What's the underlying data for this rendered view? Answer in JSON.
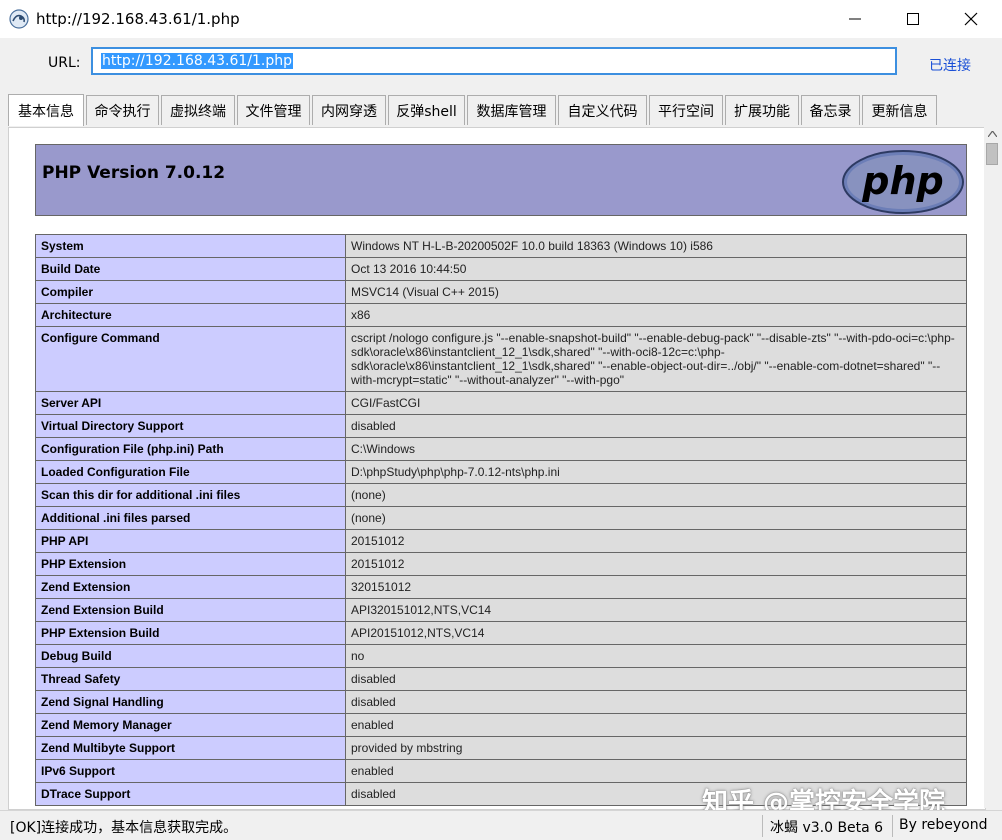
{
  "window": {
    "title": "http://192.168.43.61/1.php",
    "icon": "scorpion-app-icon",
    "controls": [
      "minimize-icon",
      "maximize-icon",
      "close-icon"
    ]
  },
  "address": {
    "label": "URL:",
    "value": "http://192.168.43.61/1.php",
    "status": "已连接"
  },
  "tabs": [
    {
      "label": "基本信息",
      "active": true
    },
    {
      "label": "命令执行"
    },
    {
      "label": "虚拟终端"
    },
    {
      "label": "文件管理"
    },
    {
      "label": "内网穿透"
    },
    {
      "label": "反弹shell"
    },
    {
      "label": "数据库管理"
    },
    {
      "label": "自定义代码"
    },
    {
      "label": "平行空间"
    },
    {
      "label": "扩展功能"
    },
    {
      "label": "备忘录"
    },
    {
      "label": "更新信息"
    }
  ],
  "phpinfo": {
    "version_title": "PHP Version 7.0.12",
    "logo_text": "php",
    "rows": [
      {
        "key": "System",
        "value": "Windows NT H-L-B-20200502F 10.0 build 18363 (Windows 10) i586"
      },
      {
        "key": "Build Date",
        "value": "Oct 13 2016 10:44:50"
      },
      {
        "key": "Compiler",
        "value": "MSVC14 (Visual C++ 2015)"
      },
      {
        "key": "Architecture",
        "value": "x86"
      },
      {
        "key": "Configure Command",
        "value": "cscript /nologo configure.js \"--enable-snapshot-build\" \"--enable-debug-pack\" \"--disable-zts\" \"--with-pdo-oci=c:\\php-sdk\\oracle\\x86\\instantclient_12_1\\sdk,shared\" \"--with-oci8-12c=c:\\php-sdk\\oracle\\x86\\instantclient_12_1\\sdk,shared\" \"--enable-object-out-dir=../obj/\" \"--enable-com-dotnet=shared\" \"--with-mcrypt=static\" \"--without-analyzer\" \"--with-pgo\""
      },
      {
        "key": "Server API",
        "value": "CGI/FastCGI"
      },
      {
        "key": "Virtual Directory Support",
        "value": "disabled"
      },
      {
        "key": "Configuration File (php.ini) Path",
        "value": "C:\\Windows"
      },
      {
        "key": "Loaded Configuration File",
        "value": "D:\\phpStudy\\php\\php-7.0.12-nts\\php.ini"
      },
      {
        "key": "Scan this dir for additional .ini files",
        "value": "(none)"
      },
      {
        "key": "Additional .ini files parsed",
        "value": "(none)"
      },
      {
        "key": "PHP API",
        "value": "20151012"
      },
      {
        "key": "PHP Extension",
        "value": "20151012"
      },
      {
        "key": "Zend Extension",
        "value": "320151012"
      },
      {
        "key": "Zend Extension Build",
        "value": "API320151012,NTS,VC14"
      },
      {
        "key": "PHP Extension Build",
        "value": "API20151012,NTS,VC14"
      },
      {
        "key": "Debug Build",
        "value": "no"
      },
      {
        "key": "Thread Safety",
        "value": "disabled"
      },
      {
        "key": "Zend Signal Handling",
        "value": "disabled"
      },
      {
        "key": "Zend Memory Manager",
        "value": "enabled"
      },
      {
        "key": "Zend Multibyte Support",
        "value": "provided by mbstring"
      },
      {
        "key": "IPv6 Support",
        "value": "enabled"
      },
      {
        "key": "DTrace Support",
        "value": "disabled"
      }
    ]
  },
  "statusbar": {
    "message": "[OK]连接成功，基本信息获取完成。",
    "version": "冰蝎 v3.0 Beta 6",
    "author": "By rebeyond"
  },
  "watermark": "知乎 @掌控安全学院",
  "colors": {
    "header_bg": "#9999cc",
    "key_bg": "#ccccff",
    "value_bg": "#dddddd",
    "url_highlight": "#3399ff",
    "link": "#1a4fd6"
  }
}
